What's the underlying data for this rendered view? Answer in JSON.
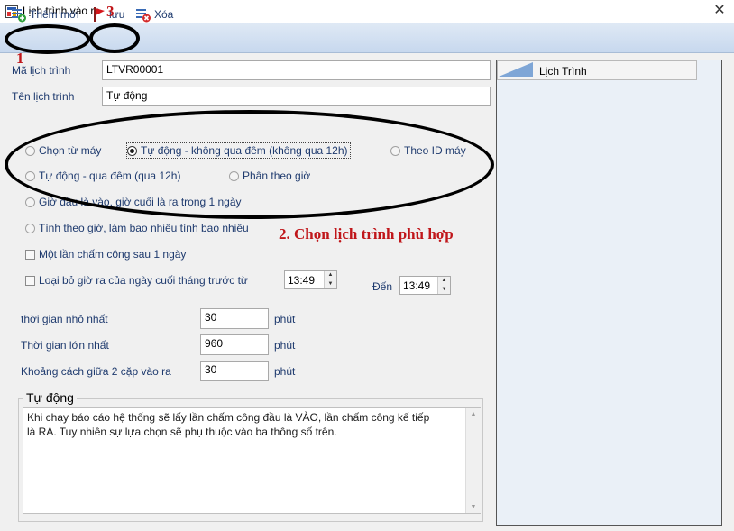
{
  "window": {
    "title": "Lịch trình vào ra",
    "close_glyph": "✕"
  },
  "toolbar": {
    "add_label": "Thêm mới",
    "save_label": "lưu",
    "delete_label": "Xóa"
  },
  "form": {
    "code_label": "Mã lịch trình",
    "code_value": "LTVR00001",
    "name_label": "Tên lịch trình",
    "name_value": "Tự động",
    "options": {
      "from_machine": "Chọn từ máy",
      "auto_no_overnight": "Tự động - không qua đêm (không qua 12h)",
      "by_machine_id": "Theo ID máy",
      "auto_overnight": "Tự động - qua đêm (qua 12h)",
      "by_hour": "Phân theo giờ",
      "first_in_last_out": "Giờ đầu là vào, giờ cuối là ra trong 1 ngày",
      "by_hours_count": "Tính theo giờ, làm bao nhiêu tính bao nhiêu",
      "selected": "auto_no_overnight"
    },
    "once_after_day_label": "Một lần chấm công sau 1 ngày",
    "remove_last_day_label": "Loại bỏ giờ ra của ngày cuối tháng trước từ",
    "from_time": "13:49",
    "to_label": "Đến",
    "to_time": "13:49",
    "min_time_label": "thời gian nhỏ nhất",
    "min_time_value": "30",
    "max_time_label": "Thời gian lớn nhất",
    "max_time_value": "960",
    "gap_label": "Khoảng cách giữa 2 cặp vào ra",
    "gap_value": "30",
    "unit": "phút"
  },
  "description": {
    "title": "Tự động",
    "line1": "Khi chạy báo cáo hệ thống sẽ lấy lần chấm công đầu là VÀO, lần chấm công kế tiếp",
    "line2": "là RA. Tuy nhiên sự lựa chọn sẽ phụ thuộc vào ba thông số trên."
  },
  "grid": {
    "column_header": "Lịch Trình"
  },
  "annotations": {
    "step1": "1",
    "step3": "3",
    "step2_text": "2. Chọn lịch trình phù hợp"
  },
  "colors": {
    "annotation_red": "#c0161a",
    "label_blue": "#1e3a6e"
  }
}
